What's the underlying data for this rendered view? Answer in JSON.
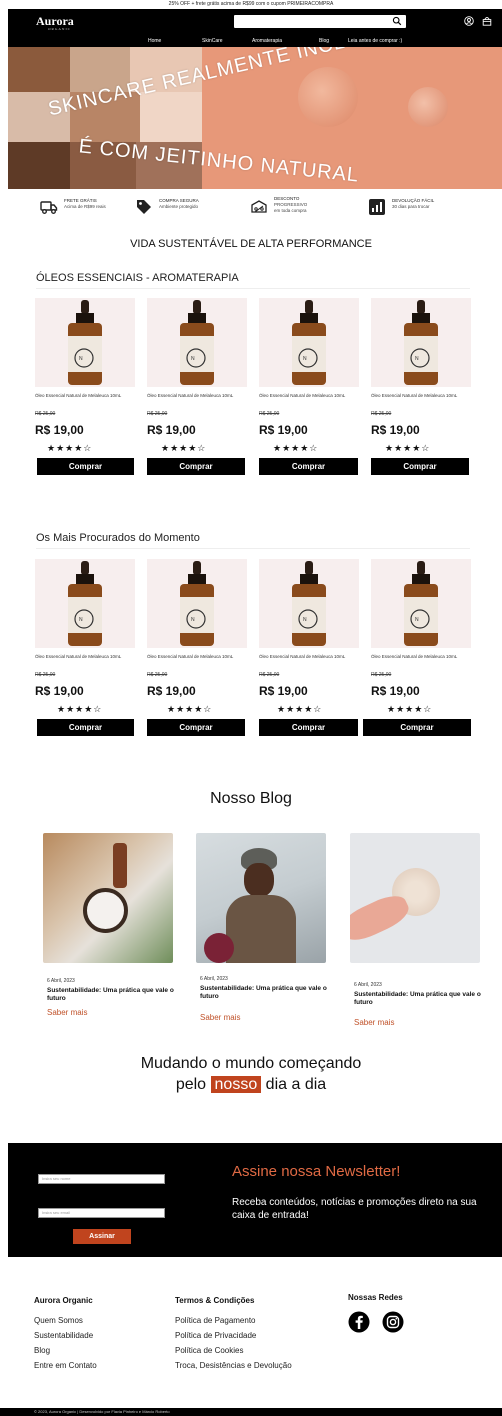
{
  "promo": "25% OFF + frete grátis acima de R$99 com o cupom PRIMEIRACOMPRA",
  "header": {
    "logo": "Aurora",
    "logo_sub": "ORGANIC",
    "search_placeholder": "",
    "nav": [
      "Home",
      "SkinCare",
      "Aromaterapia",
      "Blog",
      "Leia antes de comprar :)"
    ]
  },
  "hero": {
    "line1": "SKINCARE REALMENTE INCLUSIVO",
    "line2": "É COM JEITINHO NATURAL"
  },
  "features": [
    {
      "title": "FRETE GRÁTIS",
      "sub": "Acima de R$99 reais",
      "sub2": "",
      "icon": "truck-icon"
    },
    {
      "title": "COMPRA SEGURA",
      "sub": "Ambiente protegido",
      "sub2": "",
      "icon": "tag-icon"
    },
    {
      "title": "DESCONTO",
      "sub": "PROGRESSIVO",
      "sub2": "em toda compra",
      "icon": "discount-box-icon"
    },
    {
      "title": "DEVOLUÇÃO FÁCIL",
      "sub": "30 dias para trocar",
      "sub2": "",
      "icon": "chart-icon"
    }
  ],
  "tagline": "VIDA SUSTENTÁVEL DE ALTA PERFORMANCE",
  "sections": [
    {
      "title": "ÓLEOS ESSENCIAIS - AROMATERAPIA",
      "products": [
        {
          "name": "Óleo Essencial Natural de Melaleuca 10mL",
          "old_price": "R$ 25,00",
          "price": "R$ 19,00",
          "stars": "★★★★☆",
          "button": "Comprar"
        },
        {
          "name": "Óleo Essencial Natural de Melaleuca 10mL",
          "old_price": "R$ 25,00",
          "price": "R$ 19,00",
          "stars": "★★★★☆",
          "button": "Comprar"
        },
        {
          "name": "Óleo Essencial Natural de Melaleuca 10mL",
          "old_price": "R$ 25,00",
          "price": "R$ 19,00",
          "stars": "★★★★☆",
          "button": "Comprar"
        },
        {
          "name": "Óleo Essencial Natural de Melaleuca 10mL",
          "old_price": "R$ 25,00",
          "price": "R$ 19,00",
          "stars": "★★★★☆",
          "button": "Comprar"
        }
      ]
    },
    {
      "title": "Os Mais Procurados do Momento",
      "products": [
        {
          "name": "Óleo Essencial Natural de Melaleuca 10mL",
          "old_price": "R$ 25,00",
          "price": "R$ 19,00",
          "stars": "★★★★☆",
          "button": "Comprar"
        },
        {
          "name": "Óleo Essencial Natural de Melaleuca 10mL",
          "old_price": "R$ 25,00",
          "price": "R$ 19,00",
          "stars": "★★★★☆",
          "button": "Comprar"
        },
        {
          "name": "Óleo Essencial Natural de Melaleuca 10mL",
          "old_price": "R$ 25,00",
          "price": "R$ 19,00",
          "stars": "★★★★☆",
          "button": "Comprar"
        },
        {
          "name": "Óleo Essencial Natural de Melaleuca 10mL",
          "old_price": "R$ 25,00",
          "price": "R$ 19,00",
          "stars": "★★★★☆",
          "button": "Comprar"
        }
      ]
    }
  ],
  "blog": {
    "title": "Nosso Blog",
    "posts": [
      {
        "date": "6 Abril, 2023",
        "title": "Sustentabilidade: Uma prática que vale o futuro",
        "more": "Saber mais"
      },
      {
        "date": "6 Abril, 2023",
        "title": "Sustentabilidade: Uma prática que vale o futuro",
        "more": "Saber mais"
      },
      {
        "date": "6 Abril, 2023",
        "title": "Sustentabilidade: Uma prática que vale o futuro",
        "more": "Saber mais"
      }
    ]
  },
  "slogan": {
    "line1": "Mudando o mundo começando",
    "pre": "pelo",
    "highlight": "nosso",
    "post": "dia a dia"
  },
  "newsletter": {
    "input1_placeholder": "Insira seu nome",
    "input2_placeholder": "Insira seu email",
    "button": "Assinar",
    "heading": "Assine nossa Newsletter!",
    "text": "Receba conteúdos, notícias e promoções direto na sua caixa de entrada!"
  },
  "footer": {
    "col1": {
      "title": "Aurora Organic",
      "links": [
        "Quem Somos",
        "Sustentabilidade",
        "Blog",
        "Entre em Contato"
      ]
    },
    "col2": {
      "title": "Termos & Condições",
      "links": [
        "Política de Pagamento",
        "Política de Privacidade",
        "Política de Cookies",
        "Troca, Desistências e Devolução"
      ]
    },
    "col3": {
      "title": "Nossas Redes"
    },
    "copyright": "© 2023, Aurora Organic | Desenvolvido por Flavia Pinheiro e Márcio Roberto"
  },
  "colors": {
    "accent": "#c0441e",
    "hero": "#e79879",
    "newsletter_heading": "#e06a44"
  }
}
